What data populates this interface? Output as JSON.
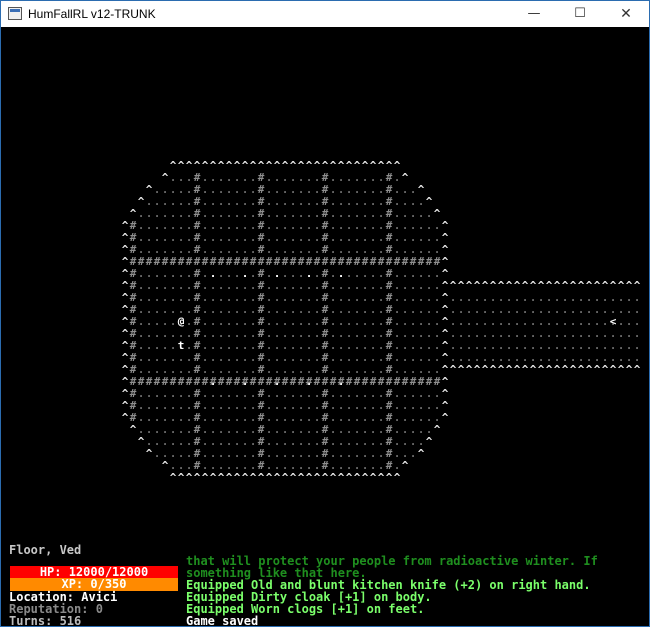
{
  "window": {
    "title": "HumFallRL v12-TRUNK",
    "minimize_glyph": "—",
    "maximize_glyph": "☐",
    "close_glyph": "✕"
  },
  "map": {
    "wall_color": "#8f8f8f",
    "floor_color": "#6a6a6a",
    "rock_color": "#e6e6e6",
    "light_color": "#ffffff",
    "player": {
      "glyph": "@",
      "color": "#ffffff"
    },
    "npc": {
      "glyph": "t",
      "color": "#ffffff"
    },
    "exit": {
      "glyph": "<",
      "color": "#ffffff"
    }
  },
  "status": {
    "tile_description": "Floor, Ved",
    "hp_label": "HP: 12000/12000",
    "hp_fraction": 1.0,
    "hp_color": "#ff0000",
    "xp_label": "XP: 0/350",
    "xp_fraction": 0.0,
    "xp_color": "#ff8a00",
    "location": "Location: Avici",
    "reputation": "Reputation: 0",
    "turns": "Turns: 516"
  },
  "messages": [
    {
      "text": "that will protect your people from radioactive winter. If",
      "color": "#1f8f1f"
    },
    {
      "text": "something like that here.",
      "color": "#1f8f1f"
    },
    {
      "text": "Equipped Old and blunt kitchen knife (+2) on right hand.",
      "color": "#7bff6b"
    },
    {
      "text": "Equipped Dirty cloak [+1] on body.",
      "color": "#7bff6b"
    },
    {
      "text": "Equipped Worn clogs [+1] on feet.",
      "color": "#7bff6b"
    },
    {
      "text": "Game saved",
      "color": "#ffffff"
    }
  ]
}
